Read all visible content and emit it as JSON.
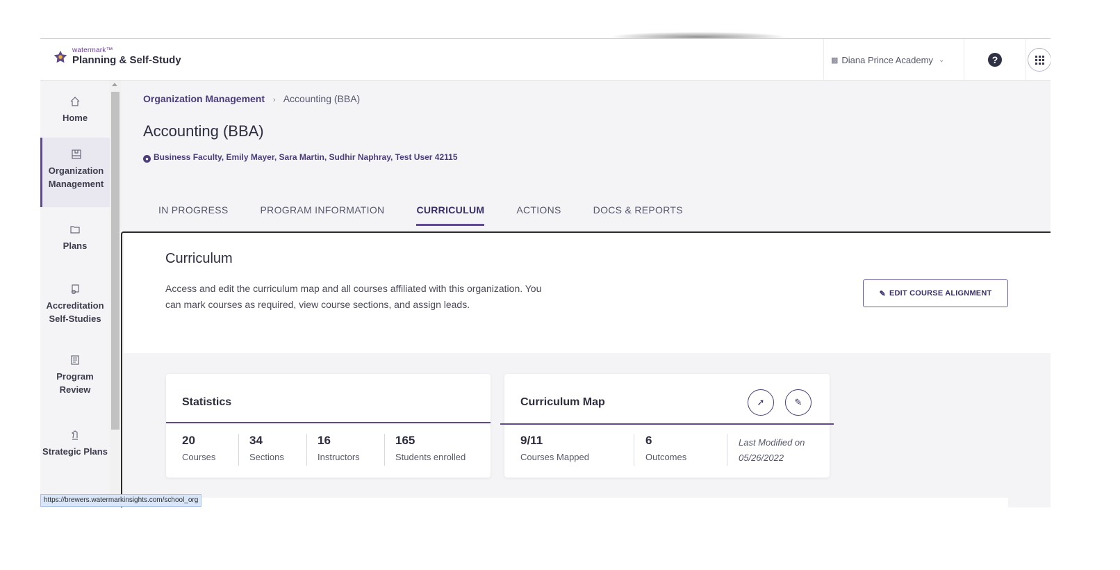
{
  "header": {
    "brand_small": "watermark",
    "brand_tm": "™",
    "brand_main": "Planning & Self-Study",
    "org_name": "Diana Prince Academy",
    "help_label": "?"
  },
  "sidebar": {
    "items": [
      {
        "label": "Home",
        "icon": "home-icon"
      },
      {
        "label": "Organization Management",
        "icon": "organization-icon"
      },
      {
        "label": "Plans",
        "icon": "folder-icon"
      },
      {
        "label": "Accreditation Self-Studies",
        "icon": "document-badge-icon"
      },
      {
        "label": "Program Review",
        "icon": "review-document-icon"
      },
      {
        "label": "Strategic Plans",
        "icon": "chess-knight-icon"
      }
    ]
  },
  "breadcrumb": {
    "root": "Organization Management",
    "current": "Accounting (BBA)"
  },
  "page": {
    "title": "Accounting (BBA)",
    "owners": "Business Faculty, Emily Mayer, Sara Martin, Sudhir Naphray, Test User 42115"
  },
  "tabs": [
    {
      "label": "IN PROGRESS"
    },
    {
      "label": "PROGRAM INFORMATION"
    },
    {
      "label": "CURRICULUM"
    },
    {
      "label": "ACTIONS"
    },
    {
      "label": "DOCS & REPORTS"
    }
  ],
  "curriculum": {
    "title": "Curriculum",
    "description": "Access and edit the curriculum map and all courses affiliated with this organization. You can mark courses as required, view course sections, and assign leads.",
    "edit_button": "EDIT COURSE ALIGNMENT"
  },
  "statistics": {
    "title": "Statistics",
    "items": [
      {
        "value": "20",
        "label": "Courses"
      },
      {
        "value": "34",
        "label": "Sections"
      },
      {
        "value": "16",
        "label": "Instructors"
      },
      {
        "value": "165",
        "label": "Students enrolled"
      }
    ]
  },
  "curriculum_map": {
    "title": "Curriculum Map",
    "mapped_value": "9/11",
    "mapped_label": "Courses Mapped",
    "outcomes_value": "6",
    "outcomes_label": "Outcomes",
    "last_modified_label": "Last Modified on",
    "last_modified_date": "05/26/2022"
  },
  "status_bar": {
    "url": "https://brewers.watermarkinsights.com/school_org"
  },
  "colors": {
    "accent": "#5e4a8c",
    "brand_text": "#4b3d7a"
  }
}
